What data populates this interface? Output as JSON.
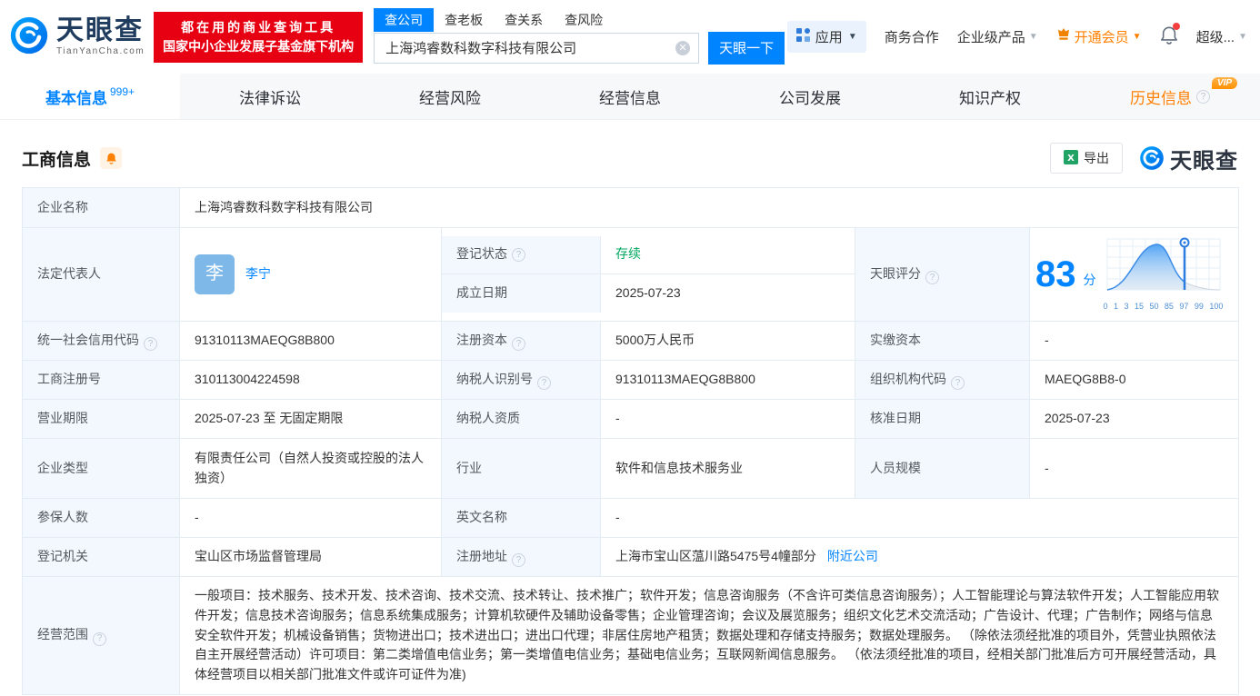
{
  "brand": {
    "name": "天眼查",
    "domain": "TianYanCha.com",
    "slogan_line1": "都在用的商业查询工具",
    "slogan_line2": "国家中小企业发展子基金旗下机构",
    "primary_color": "#0084ff",
    "badge_red": "#e60012"
  },
  "search": {
    "tabs": [
      {
        "label": "查公司",
        "active": true
      },
      {
        "label": "查老板",
        "active": false
      },
      {
        "label": "查关系",
        "active": false
      },
      {
        "label": "查风险",
        "active": false
      }
    ],
    "value": "上海鸿睿数科数字科技有限公司",
    "submit_label": "天眼一下"
  },
  "top_nav": {
    "apps_label": "应用",
    "biz_coop": "商务合作",
    "enterprise_product": "企业级产品",
    "open_member": "开通会员",
    "super": "超级..."
  },
  "tabbar": {
    "tabs": [
      {
        "label": "基本信息",
        "badge": "999+"
      },
      {
        "label": "法律诉讼"
      },
      {
        "label": "经营风险"
      },
      {
        "label": "经营信息"
      },
      {
        "label": "公司发展"
      },
      {
        "label": "知识产权"
      },
      {
        "label": "历史信息",
        "vip": "VIP"
      }
    ]
  },
  "section": {
    "title": "工商信息",
    "export_label": "导出",
    "watermark": "天眼查"
  },
  "score_chart": {
    "type": "area",
    "score": "83",
    "unit": "分",
    "marker_value": 83,
    "x_ticks": [
      "0",
      "1",
      "3",
      "15",
      "50",
      "85",
      "97",
      "99",
      "100"
    ]
  },
  "fields": {
    "company_name": {
      "label": "企业名称",
      "value": "上海鸿睿数科数字科技有限公司"
    },
    "legal_rep": {
      "label": "法定代表人",
      "value": "李宁",
      "avatar": "李"
    },
    "reg_status": {
      "label": "登记状态",
      "value": "存续"
    },
    "establish_date": {
      "label": "成立日期",
      "value": "2025-07-23"
    },
    "tyc_score": {
      "label": "天眼评分"
    },
    "credit_code": {
      "label": "统一社会信用代码",
      "value": "91310113MAEQG8B800"
    },
    "reg_capital": {
      "label": "注册资本",
      "value": "5000万人民币"
    },
    "paid_capital": {
      "label": "实缴资本",
      "value": "-"
    },
    "reg_number": {
      "label": "工商注册号",
      "value": "310113004224598"
    },
    "taxpayer_id": {
      "label": "纳税人识别号",
      "value": "91310113MAEQG8B800"
    },
    "org_code": {
      "label": "组织机构代码",
      "value": "MAEQG8B8-0"
    },
    "business_term": {
      "label": "营业期限",
      "value": "2025-07-23 至 无固定期限"
    },
    "taxpayer_quality": {
      "label": "纳税人资质",
      "value": "-"
    },
    "approval_date": {
      "label": "核准日期",
      "value": "2025-07-23"
    },
    "company_type": {
      "label": "企业类型",
      "value": "有限责任公司（自然人投资或控股的法人独资）"
    },
    "industry": {
      "label": "行业",
      "value": "软件和信息技术服务业"
    },
    "staff_size": {
      "label": "人员规模",
      "value": "-"
    },
    "insured_count": {
      "label": "参保人数",
      "value": "-"
    },
    "english_name": {
      "label": "英文名称",
      "value": "-"
    },
    "reg_authority": {
      "label": "登记机关",
      "value": "宝山区市场监督管理局"
    },
    "reg_address": {
      "label": "注册地址",
      "value": "上海市宝山区蕰川路5475号4幢部分",
      "link": "附近公司"
    },
    "business_scope": {
      "label": "经营范围",
      "value": "一般项目：技术服务、技术开发、技术咨询、技术交流、技术转让、技术推广；软件开发；信息咨询服务（不含许可类信息咨询服务）；人工智能理论与算法软件开发；人工智能应用软件开发；信息技术咨询服务；信息系统集成服务；计算机软硬件及辅助设备零售；企业管理咨询；会议及展览服务；组织文化艺术交流活动；广告设计、代理；广告制作；网络与信息安全软件开发；机械设备销售；货物进出口；技术进出口；进出口代理；非居住房地产租赁；数据处理和存储支持服务；数据处理服务。 （除依法须经批准的项目外，凭营业执照依法自主开展经营活动）许可项目：第二类增值电信业务；第一类增值电信业务；基础电信业务；互联网新闻信息服务。 （依法须经批准的项目，经相关部门批准后方可开展经营活动，具体经营项目以相关部门批准文件或许可证件为准)"
    }
  }
}
